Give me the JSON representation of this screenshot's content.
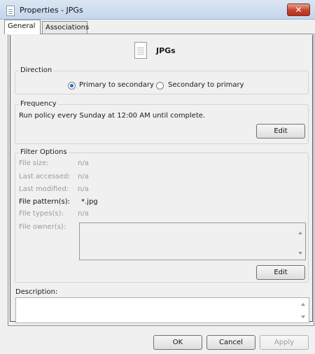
{
  "window": {
    "title": "Properties - JPGs",
    "close_glyph": "✕"
  },
  "tabs": [
    {
      "label": "General",
      "active": true
    },
    {
      "label": "Associations",
      "active": false
    }
  ],
  "header": {
    "icon": "document-icon",
    "title": "JPGs"
  },
  "direction": {
    "label": "Direction",
    "options": [
      {
        "label": "Primary to secondary",
        "selected": true
      },
      {
        "label": "Secondary to primary",
        "selected": false
      }
    ]
  },
  "frequency": {
    "label": "Frequency",
    "text": "Run policy every Sunday at 12:00 AM until complete.",
    "edit_label": "Edit"
  },
  "filter": {
    "label": "Filter Options",
    "rows": [
      {
        "label": "File size:",
        "value": "n/a"
      },
      {
        "label": "Last accessed:",
        "value": "n/a"
      },
      {
        "label": "Last modified:",
        "value": "n/a"
      },
      {
        "label": "File pattern(s):",
        "value": "*.jpg"
      },
      {
        "label": "File types(s):",
        "value": "n/a"
      },
      {
        "label": "File owner(s):",
        "value": ""
      }
    ],
    "edit_label": "Edit"
  },
  "description": {
    "label": "Description:",
    "value": ""
  },
  "footer": {
    "ok_label": "OK",
    "cancel_label": "Cancel",
    "apply_label": "Apply"
  },
  "colors": {
    "close_button": "#c4422c",
    "radio_selected": "#1e6fcc",
    "disabled_text": "#9a9a9a"
  }
}
